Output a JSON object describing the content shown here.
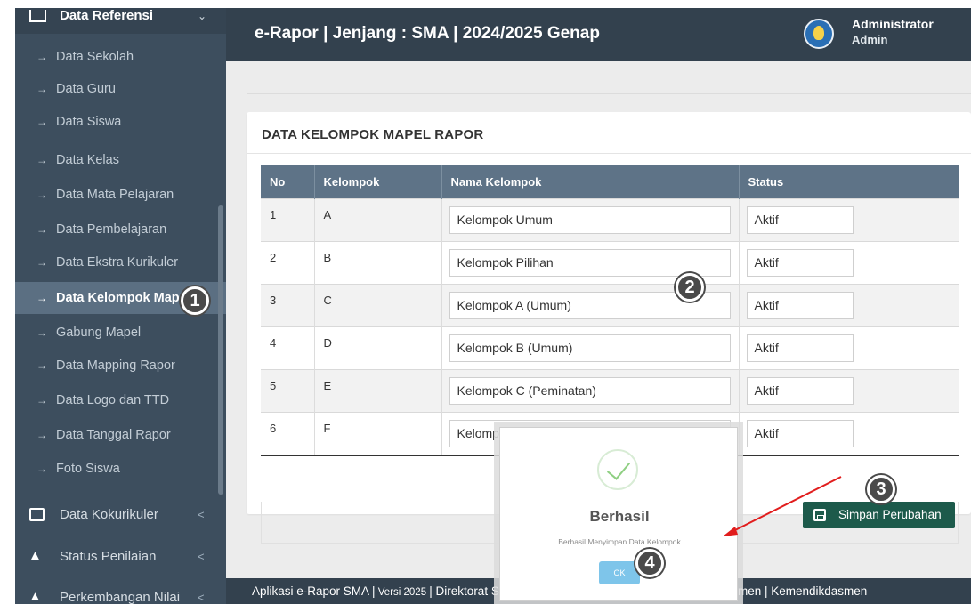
{
  "sidebar": {
    "header": "Data Referensi",
    "items": [
      {
        "label": "Data Sekolah"
      },
      {
        "label": "Data Guru"
      },
      {
        "label": "Data Siswa"
      },
      {
        "label": "Data Kelas"
      },
      {
        "label": "Data Mata Pelajaran"
      },
      {
        "label": "Data Pembelajaran"
      },
      {
        "label": "Data Ekstra Kurikuler"
      },
      {
        "label": "Data Kelompok Mapel",
        "active": true
      },
      {
        "label": "Gabung Mapel"
      },
      {
        "label": "Data Mapping Rapor"
      },
      {
        "label": "Data Logo dan TTD"
      },
      {
        "label": "Data Tanggal Rapor"
      },
      {
        "label": "Foto Siswa"
      }
    ],
    "groups": [
      {
        "label": "Data Kokurikuler"
      },
      {
        "label": "Status Penilaian"
      },
      {
        "label": "Perkembangan Nilai"
      }
    ]
  },
  "header": {
    "title": "e-Rapor | Jenjang : SMA | 2024/2025 Genap",
    "user_name": "Administrator",
    "user_role": "Admin"
  },
  "card": {
    "title": "DATA KELOMPOK MAPEL RAPOR",
    "columns": [
      "No",
      "Kelompok",
      "Nama Kelompok",
      "Status"
    ],
    "rows": [
      {
        "no": "1",
        "kelompok": "A",
        "nama": "Kelompok Umum",
        "status": "Aktif"
      },
      {
        "no": "2",
        "kelompok": "B",
        "nama": "Kelompok Pilihan",
        "status": "Aktif"
      },
      {
        "no": "3",
        "kelompok": "C",
        "nama": "Kelompok A (Umum)",
        "status": "Aktif"
      },
      {
        "no": "4",
        "kelompok": "D",
        "nama": "Kelompok B (Umum)",
        "status": "Aktif"
      },
      {
        "no": "5",
        "kelompok": "E",
        "nama": "Kelompok C (Peminatan)",
        "status": "Aktif"
      },
      {
        "no": "6",
        "kelompok": "F",
        "nama": "Kelompok F",
        "status": "Aktif"
      }
    ],
    "save_label": "Simpan Perubahan"
  },
  "footer": {
    "app": "Aplikasi e-Rapor SMA |",
    "version": " Versi 2025 ",
    "credit": "| Direktorat Sekolah Menengah Atas | Ditjen PAUD Dikdasmen | Kemendikdasmen"
  },
  "modal": {
    "title": "Berhasil",
    "message": "Berhasil Menyimpan Data Kelompok",
    "ok_label": "OK"
  },
  "annotations": [
    "1",
    "2",
    "3",
    "4"
  ],
  "colors": {
    "sidebar": "#3d4e5e",
    "header": "#33414e",
    "table_header": "#5e7387",
    "save_button": "#1d5a4b",
    "arrow": "#e11d1d"
  }
}
